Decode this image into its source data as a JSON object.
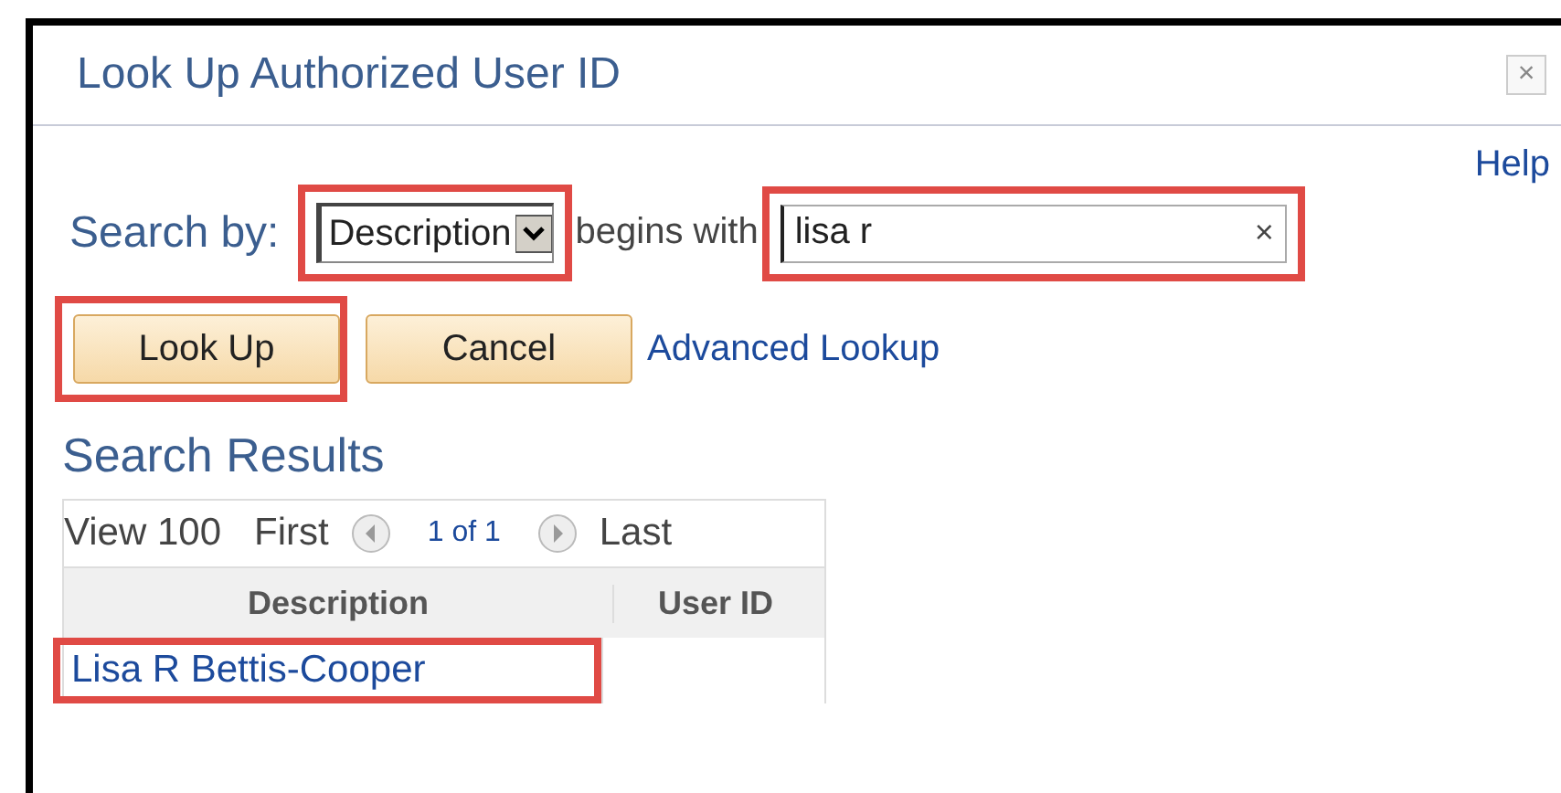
{
  "window": {
    "title": "Look Up Authorized User ID",
    "close": "×"
  },
  "help": "Help",
  "search": {
    "label": "Search by:",
    "field": {
      "value": "Description",
      "highlighted": true
    },
    "operator": "begins with",
    "input": {
      "value": "lisa r",
      "clear": "×",
      "highlighted": true
    }
  },
  "buttons": [
    {
      "label": "Look Up",
      "highlighted": true
    },
    {
      "label": "Cancel",
      "highlighted": false
    }
  ],
  "advanced_link": "Advanced Lookup",
  "results": {
    "title": "Search Results",
    "nav": {
      "view": "View 100",
      "first": "First",
      "count": "1 of 1",
      "last": "Last"
    },
    "columns": [
      "Description",
      "User ID"
    ],
    "rows": [
      {
        "description": "Lisa R Bettis-Cooper",
        "user_id": "",
        "highlighted": true
      }
    ]
  }
}
